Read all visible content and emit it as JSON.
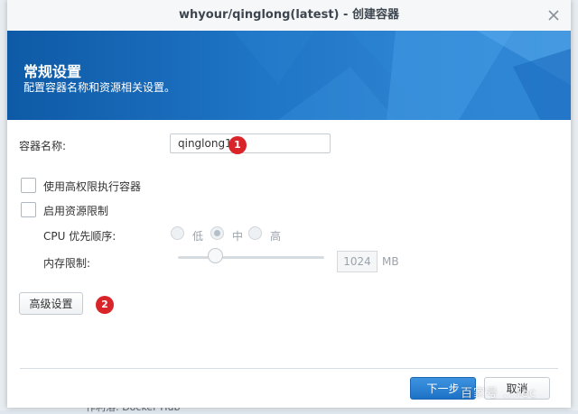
{
  "window": {
    "title": "whyour/qinglong(latest) - 创建容器"
  },
  "banner": {
    "title": "常规设置",
    "subtitle": "配置容器名称和资源相关设置。"
  },
  "form": {
    "container_name_label": "容器名称:",
    "container_name_value": "qinglong1",
    "privileged_label": "使用高权限执行容器",
    "privileged_checked": false,
    "resource_limit_label": "启用资源限制",
    "resource_limit_checked": false,
    "cpu_priority_label": "CPU 优先顺序:",
    "cpu_options": [
      {
        "label": "低",
        "selected": false
      },
      {
        "label": "中",
        "selected": true
      },
      {
        "label": "高",
        "selected": false
      }
    ],
    "memory_limit_label": "内存限制:",
    "memory_value": "1024",
    "memory_unit": "MB",
    "advanced_button": "高级设置"
  },
  "annotations": {
    "badge_1": "1",
    "badge_2": "2"
  },
  "footer": {
    "next_button": "下一步",
    "cancel_button": "取消"
  },
  "background": {
    "partial_text": "作利落: Docker Hub"
  },
  "watermark": "百家号 ...lec",
  "colors": {
    "banner": "#1f75c6",
    "badge": "#d9252a",
    "primary_button": "#1d72c6"
  }
}
